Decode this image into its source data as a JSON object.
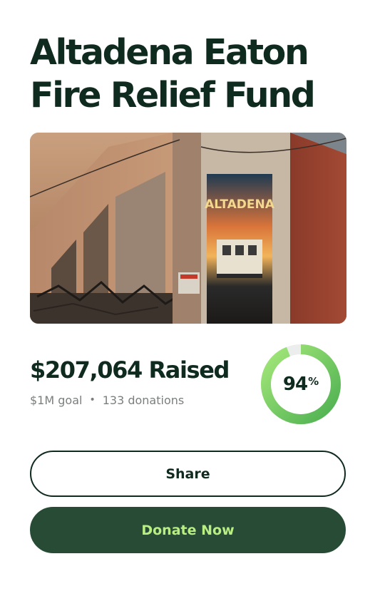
{
  "page": {
    "title": "Altadena Eaton Fire Relief Fund"
  },
  "hero_image": {
    "sign_text": "ALTADENA",
    "icon": "burned-building-photo"
  },
  "fundraising": {
    "raised_label": "$207,064 Raised",
    "goal_label": "$1M goal",
    "separator": "•",
    "donations_label": "133 donations",
    "progress_value": "94",
    "progress_unit": "%",
    "progress_fraction": 0.94
  },
  "actions": {
    "share_label": "Share",
    "donate_label": "Donate Now"
  },
  "colors": {
    "brand_dark": "#0f2a1e",
    "donate_bg": "#274b35",
    "donate_text": "#b9ef82",
    "ring_start": "#4caf50",
    "ring_end": "#a5e87a",
    "ring_track": "#ebeeec"
  }
}
